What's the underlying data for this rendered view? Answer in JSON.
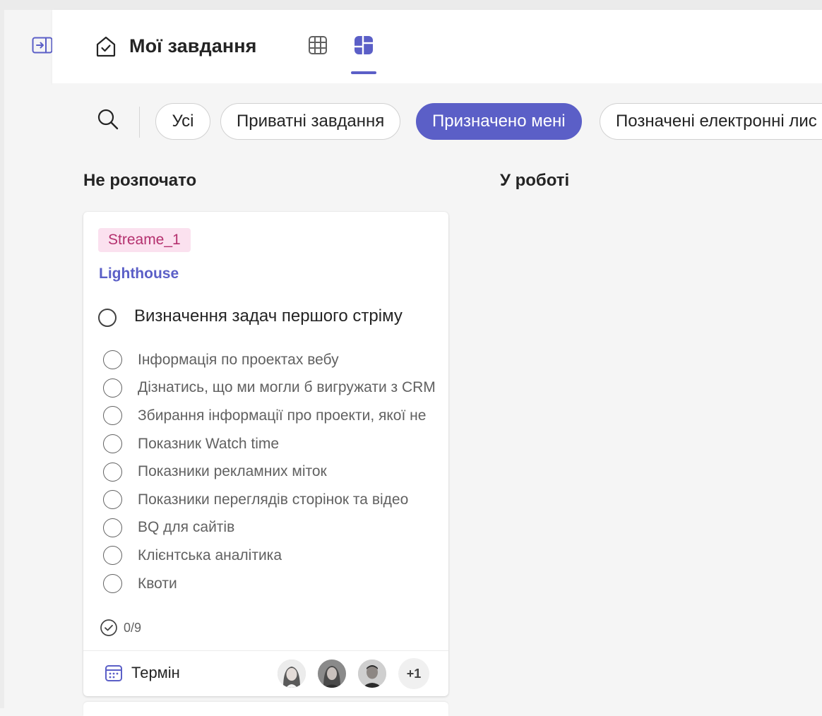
{
  "header": {
    "title": "Мої завдання"
  },
  "filters": [
    {
      "label": "Усі",
      "active": false
    },
    {
      "label": "Приватні завдання",
      "active": false
    },
    {
      "label": "Призначено мені",
      "active": true
    },
    {
      "label": "Позначені електронні лис",
      "active": false
    }
  ],
  "columns": [
    {
      "title": "Не розпочато"
    },
    {
      "title": "У роботі"
    }
  ],
  "card": {
    "tag": "Streame_1",
    "plan": "Lighthouse",
    "title": "Визначення задач першого стріму",
    "checklist": [
      "Інформація по проектах вебу",
      "Дізнатись, що ми могли б вигружати з CRM",
      "Збирання інформації про проекти, якої не",
      "Показник Watch time",
      "Показники рекламних міток",
      "Показники переглядів сторінок та відео",
      "BQ для сайтів",
      "Клієнтська аналітика",
      "Квоти"
    ],
    "progress": "0/9",
    "due_label": "Термін",
    "assignees_more": "+1"
  },
  "colors": {
    "accent": "#5b5fc7",
    "tag_bg": "#fbe1ef",
    "tag_text": "#b4306e"
  },
  "icons": {
    "collapse": "panel-expand-icon",
    "home": "home-check-icon",
    "grid_view": "grid-view-icon",
    "board_view": "board-view-icon",
    "search": "search-icon",
    "progress": "check-circle-icon",
    "due": "calendar-icon"
  }
}
